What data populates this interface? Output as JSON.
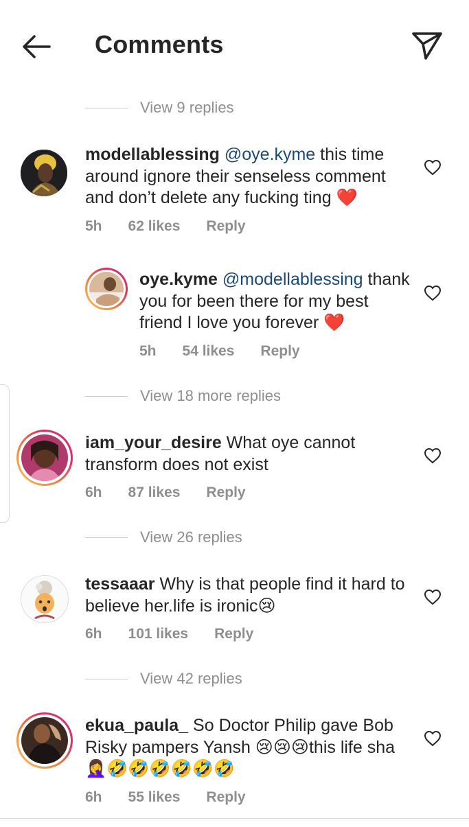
{
  "header": {
    "title": "Comments"
  },
  "view_replies": [
    {
      "label": "View 9 replies"
    },
    {
      "label": "View 18 more replies"
    },
    {
      "label": "View 26 replies"
    },
    {
      "label": "View 42 replies"
    }
  ],
  "comments": [
    {
      "user": "modellablessing",
      "mention": "@oye.kyme",
      "text": " this time around ignore their senseless comment and don’t delete any fucking ting ❤️",
      "time": "5h",
      "likes": "62 likes",
      "reply": "Reply"
    },
    {
      "user": "oye.kyme",
      "mention": "@modellablessing",
      "text": " thank you for been there for my best friend I love you forever ❤️",
      "time": "5h",
      "likes": "54 likes",
      "reply": "Reply"
    },
    {
      "user": "iam_your_desire",
      "mention": "",
      "text": " What oye cannot transform does not exist",
      "time": "6h",
      "likes": "87 likes",
      "reply": "Reply"
    },
    {
      "user": "tessaaar",
      "mention": "",
      "text": " Why is that people find it hard to believe her.life is ironic😢",
      "time": "6h",
      "likes": "101 likes",
      "reply": "Reply"
    },
    {
      "user": "ekua_paula_",
      "mention": "",
      "text": " So Doctor Philip gave Bob Risky pampers Yansh 😢😢😢this life sha 🤦‍♀️🤣🤣🤣🤣🤣🤣",
      "time": "6h",
      "likes": "55 likes",
      "reply": "Reply"
    }
  ],
  "icons": {
    "back": "arrow-left-icon",
    "send": "paper-plane-icon",
    "like": "heart-outline-icon"
  },
  "colors": {
    "text": "#262626",
    "muted": "#8e8e8e",
    "mention": "#1c4978",
    "heart_red": "#e0262b"
  }
}
